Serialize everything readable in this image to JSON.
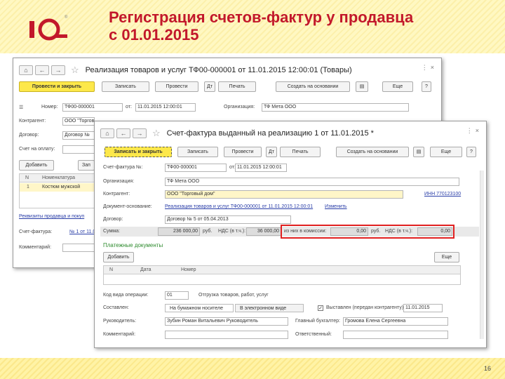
{
  "slide": {
    "title_line1": "Регистрация счетов-фактур у продавца",
    "title_line2": "с 01.01.2015",
    "page": "16"
  },
  "logo": {
    "mark": "1С",
    "reg": "®"
  },
  "w1": {
    "title": "Реализация товаров и услуг ТФ00-000001 от 11.01.2015 12:00:01 (Товары)",
    "buttons": {
      "post_close": "Провести и закрыть",
      "save": "Записать",
      "post": "Провести",
      "print": "Печать",
      "create_based": "Создать на основании",
      "more": "Еще",
      "help": "?"
    },
    "number_label": "Номер:",
    "number_value": "ТФ00-000001",
    "from_label": "от:",
    "date_value": "11.01.2015 12:00:01",
    "org_label": "Организация:",
    "org_value": "ТФ Мета ООО",
    "contractor_label": "Контрагент:",
    "contractor_value": "ООО \"Торгов",
    "contract_label": "Договор:",
    "contract_value": "Договор №",
    "invoice_to_pay_label": "Счет на оплату:",
    "add_button": "Добавить",
    "table_headers": [
      "N",
      "Номенклатура"
    ],
    "row1": [
      "1",
      "Костюм мужской"
    ],
    "invoice_link": "Реквизиты продавца и покуп",
    "invoice_label": "Счет-фактура:",
    "invoice_value": "№ 1 от 11.01",
    "comment_label": "Комментарий:"
  },
  "w2": {
    "title": "Счет-фактура выданный на реализацию 1 от 11.01.2015 *",
    "buttons": {
      "save_close": "Записать и закрыть",
      "save": "Записать",
      "post": "Провести",
      "print": "Печать",
      "create_based": "Создать на основании",
      "more": "Еще",
      "help": "?"
    },
    "invoice_num_label": "Счет-фактура №:",
    "invoice_num_value": "ТФ00-000001",
    "from_label": "от:",
    "date_value": "11.01.2015 12:00:01",
    "org_label": "Организация:",
    "org_value": "ТФ Мета ООО",
    "contractor_label": "Контрагент:",
    "contractor_value": "ООО \"Торговый дом\"",
    "contractor_inn": "ИНН 770123100",
    "base_doc_label": "Документ-основание:",
    "base_doc_value": "Реализация товаров и услуг ТФ00-000001 от 11.01.2015 12:00:01",
    "change_link": "Изменить",
    "contract_label": "Договор:",
    "contract_value": "Договор № 5 от 05.04.2013",
    "sum_label": "Сумма:",
    "sum_value": "236 000,00",
    "currency": "руб.",
    "vat_label": "НДС (в т.ч.):",
    "vat_value": "36 000,00",
    "commission_label": "из них в комиссии:",
    "commission_sum": "0,00",
    "commission_currency": "руб.",
    "commission_vat_label": "НДС (в т.ч.):",
    "commission_vat": "0,00",
    "payments_title": "Платежные документы",
    "add_button": "Добавить",
    "more": "Еще",
    "pay_headers": [
      "N",
      "Дата",
      "Номер"
    ],
    "op_code_label": "Код вида операции:",
    "op_code_value": "01",
    "op_code_desc": "Отгрузка товаров, работ, услуг",
    "composed_label": "Составлен:",
    "paper_option": "На бумажном носителе",
    "electronic_option": "В электронном виде",
    "issued_label": "Выставлен (передан контрагенту):",
    "issued_date": "11.01.2015",
    "head_label": "Руководитель:",
    "head_value": "Зубин Роман Витальевич Руководитель",
    "accountant_label": "Главный бухгалтер:",
    "accountant_value": "Громова Елена Сергеевна",
    "comment_label": "Комментарий:",
    "responsible_label": "Ответственный:"
  }
}
